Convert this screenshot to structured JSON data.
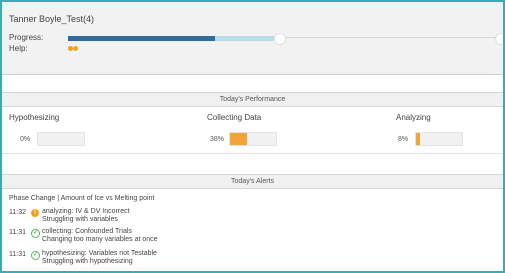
{
  "header": {
    "student_name": "Tanner Boyle_Test(4)",
    "progress_label": "Progress:",
    "help_label": "Help:",
    "progress_fraction": 0.34,
    "help_count": 2
  },
  "performance": {
    "title": "Today's Performance",
    "phases": [
      {
        "name": "Hypothesizing",
        "value_text": "0%",
        "value": 0
      },
      {
        "name": "Collecting Data",
        "value_text": "38%",
        "value": 38
      },
      {
        "name": "Analyzing",
        "value_text": "8%",
        "value": 8
      }
    ]
  },
  "alerts": {
    "title": "Today's Alerts",
    "header_text": "Phase Change  |  Amount of Ice vs Melting point",
    "items": [
      {
        "time": "11:32",
        "icon": "warning-icon",
        "line1": "analyzing: IV & DV Incorrect",
        "line2": "Struggling with variables"
      },
      {
        "time": "11:31",
        "icon": "check-circle-icon",
        "line1": "collecting: Confounded Trials",
        "line2": "Changing too many variables at once"
      },
      {
        "time": "11:31",
        "icon": "check-circle-icon",
        "line1": "hypothesizing: Variables not Testable",
        "line2": "Struggling with hypothesizing"
      }
    ]
  },
  "colors": {
    "frame_border": "#3aaab8",
    "progress_dark": "#2f6c9b",
    "progress_light": "#b9dde8",
    "meter_fill": "#f0a43a",
    "warning": "#f0a21a",
    "ok": "#52b85a"
  }
}
